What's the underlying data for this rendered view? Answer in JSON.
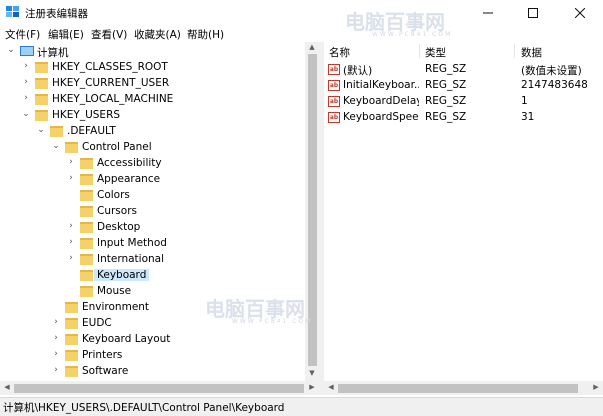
{
  "window": {
    "title": "注册表编辑器"
  },
  "menu": [
    "文件(F)",
    "编辑(E)",
    "查看(V)",
    "收藏夹(A)",
    "帮助(H)"
  ],
  "tree": [
    {
      "label": "计算机",
      "expander": "expanded",
      "icon": "computer-icon"
    },
    {
      "label": "HKEY_CLASSES_ROOT",
      "expander": "collapsed",
      "icon": "folder-icon"
    },
    {
      "label": "HKEY_CURRENT_USER",
      "expander": "collapsed",
      "icon": "folder-icon"
    },
    {
      "label": "HKEY_LOCAL_MACHINE",
      "expander": "collapsed",
      "icon": "folder-icon"
    },
    {
      "label": "HKEY_USERS",
      "expander": "expanded",
      "icon": "folder-icon"
    },
    {
      "label": ".DEFAULT",
      "expander": "expanded",
      "icon": "folder-icon"
    },
    {
      "label": "Control Panel",
      "expander": "expanded",
      "icon": "folder-icon"
    },
    {
      "label": "Accessibility",
      "expander": "collapsed",
      "icon": "folder-icon"
    },
    {
      "label": "Appearance",
      "expander": "collapsed",
      "icon": "folder-icon"
    },
    {
      "label": "Colors",
      "expander": "none",
      "icon": "folder-icon"
    },
    {
      "label": "Cursors",
      "expander": "none",
      "icon": "folder-icon"
    },
    {
      "label": "Desktop",
      "expander": "collapsed",
      "icon": "folder-icon"
    },
    {
      "label": "Input Method",
      "expander": "collapsed",
      "icon": "folder-icon"
    },
    {
      "label": "International",
      "expander": "collapsed",
      "icon": "folder-icon"
    },
    {
      "label": "Keyboard",
      "expander": "none",
      "icon": "folder-icon",
      "selected": true
    },
    {
      "label": "Mouse",
      "expander": "none",
      "icon": "folder-icon"
    },
    {
      "label": "Environment",
      "expander": "none",
      "icon": "folder-icon"
    },
    {
      "label": "EUDC",
      "expander": "collapsed",
      "icon": "folder-icon"
    },
    {
      "label": "Keyboard Layout",
      "expander": "collapsed",
      "icon": "folder-icon"
    },
    {
      "label": "Printers",
      "expander": "collapsed",
      "icon": "folder-icon"
    },
    {
      "label": "Software",
      "expander": "collapsed",
      "icon": "folder-icon"
    }
  ],
  "columns": [
    "名称",
    "类型",
    "数据"
  ],
  "values": [
    {
      "name": "(默认)",
      "type": "REG_SZ",
      "data": "(数值未设置)"
    },
    {
      "name": "InitialKeyboar...",
      "type": "REG_SZ",
      "data": "2147483648"
    },
    {
      "name": "KeyboardDelay",
      "type": "REG_SZ",
      "data": "1"
    },
    {
      "name": "KeyboardSpeed",
      "type": "REG_SZ",
      "data": "31"
    }
  ],
  "status": "计算机\\HKEY_USERS\\.DEFAULT\\Control Panel\\Keyboard",
  "watermark": {
    "text": "电脑百事网",
    "sub": "WWW.PC841.COM"
  },
  "colors": {
    "selection": "#cce8ff",
    "folder": "#f5d16b",
    "statusbar": "#f0f0f0"
  }
}
